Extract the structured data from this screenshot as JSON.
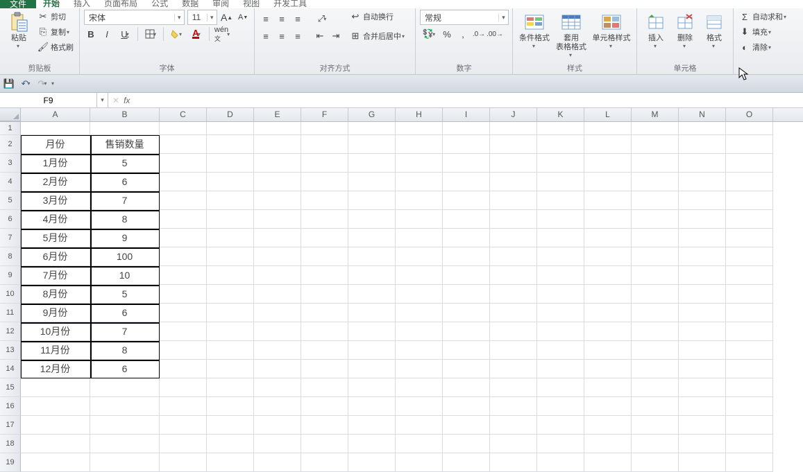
{
  "tabs": {
    "file": "文件",
    "items": [
      "开始",
      "插入",
      "页面布局",
      "公式",
      "数据",
      "审阅",
      "视图",
      "开发工具"
    ],
    "active_index": 0
  },
  "ribbon": {
    "clipboard": {
      "paste": "粘贴",
      "cut": "剪切",
      "copy": "复制",
      "format_painter": "格式刷",
      "label": "剪贴板"
    },
    "font": {
      "name": "宋体",
      "size": "11",
      "bold": "B",
      "italic": "I",
      "underline": "U",
      "label": "字体"
    },
    "align": {
      "wrap": "自动换行",
      "merge": "合并后居中",
      "label": "对齐方式"
    },
    "number": {
      "format": "常规",
      "label": "数字"
    },
    "styles": {
      "cond": "条件格式",
      "table": "套用\n表格格式",
      "cell": "单元格样式",
      "label": "样式"
    },
    "cells": {
      "insert": "插入",
      "delete": "删除",
      "format": "格式",
      "label": "单元格"
    },
    "editing": {
      "sum": "自动求和",
      "fill": "填充",
      "clear": "清除"
    }
  },
  "namebox": {
    "cell": "F9"
  },
  "columns": [
    "A",
    "B",
    "C",
    "D",
    "E",
    "F",
    "G",
    "H",
    "I",
    "J",
    "K",
    "L",
    "M",
    "N",
    "O"
  ],
  "col_widths": {
    "row_head": 30,
    "A": 100,
    "B": 100,
    "default": 68
  },
  "row_count": 19,
  "table": {
    "header": [
      "月份",
      "售销数量"
    ],
    "rows": [
      [
        "1月份",
        "5"
      ],
      [
        "2月份",
        "6"
      ],
      [
        "3月份",
        "7"
      ],
      [
        "4月份",
        "8"
      ],
      [
        "5月份",
        "9"
      ],
      [
        "6月份",
        "100"
      ],
      [
        "7月份",
        "10"
      ],
      [
        "8月份",
        "5"
      ],
      [
        "9月份",
        "6"
      ],
      [
        "10月份",
        "7"
      ],
      [
        "11月份",
        "8"
      ],
      [
        "12月份",
        "6"
      ]
    ]
  }
}
